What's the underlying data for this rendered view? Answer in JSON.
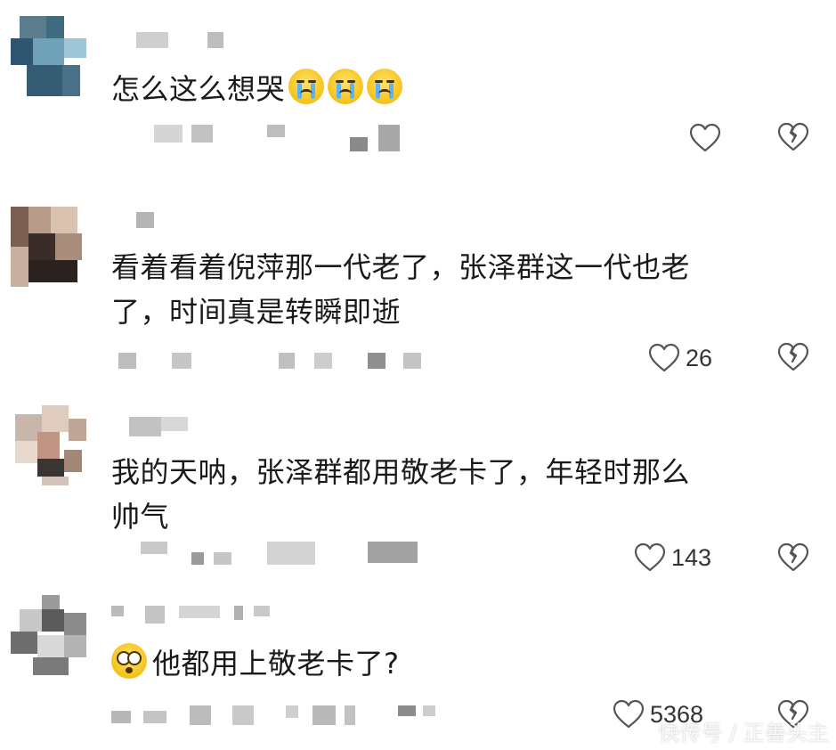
{
  "comments": [
    {
      "text_lines": [
        "怎么这么想哭"
      ],
      "emojis": [
        "crying-face",
        "crying-face",
        "crying-face"
      ],
      "likes": ""
    },
    {
      "text_lines": [
        "看着看着倪萍那一代老了，张泽群这一代也老",
        "了，时间真是转瞬即逝"
      ],
      "likes": "26"
    },
    {
      "text_lines": [
        "我的天呐，张泽群都用敬老卡了，年轻时那么",
        "帅气"
      ],
      "likes": "143"
    },
    {
      "text_lines": [
        "他都用上敬老卡了?"
      ],
      "emojis_leading": [
        "shocked-face"
      ],
      "likes": "5368"
    }
  ],
  "icons": {
    "like": "heart-outline-icon",
    "dislike": "broken-heart-icon"
  },
  "colors": {
    "background": "#ffffff",
    "text": "#1a1a1a",
    "icon_stroke": "#555555",
    "emoji": "#f5c21b"
  },
  "watermark": "快传号 / 正善头主"
}
